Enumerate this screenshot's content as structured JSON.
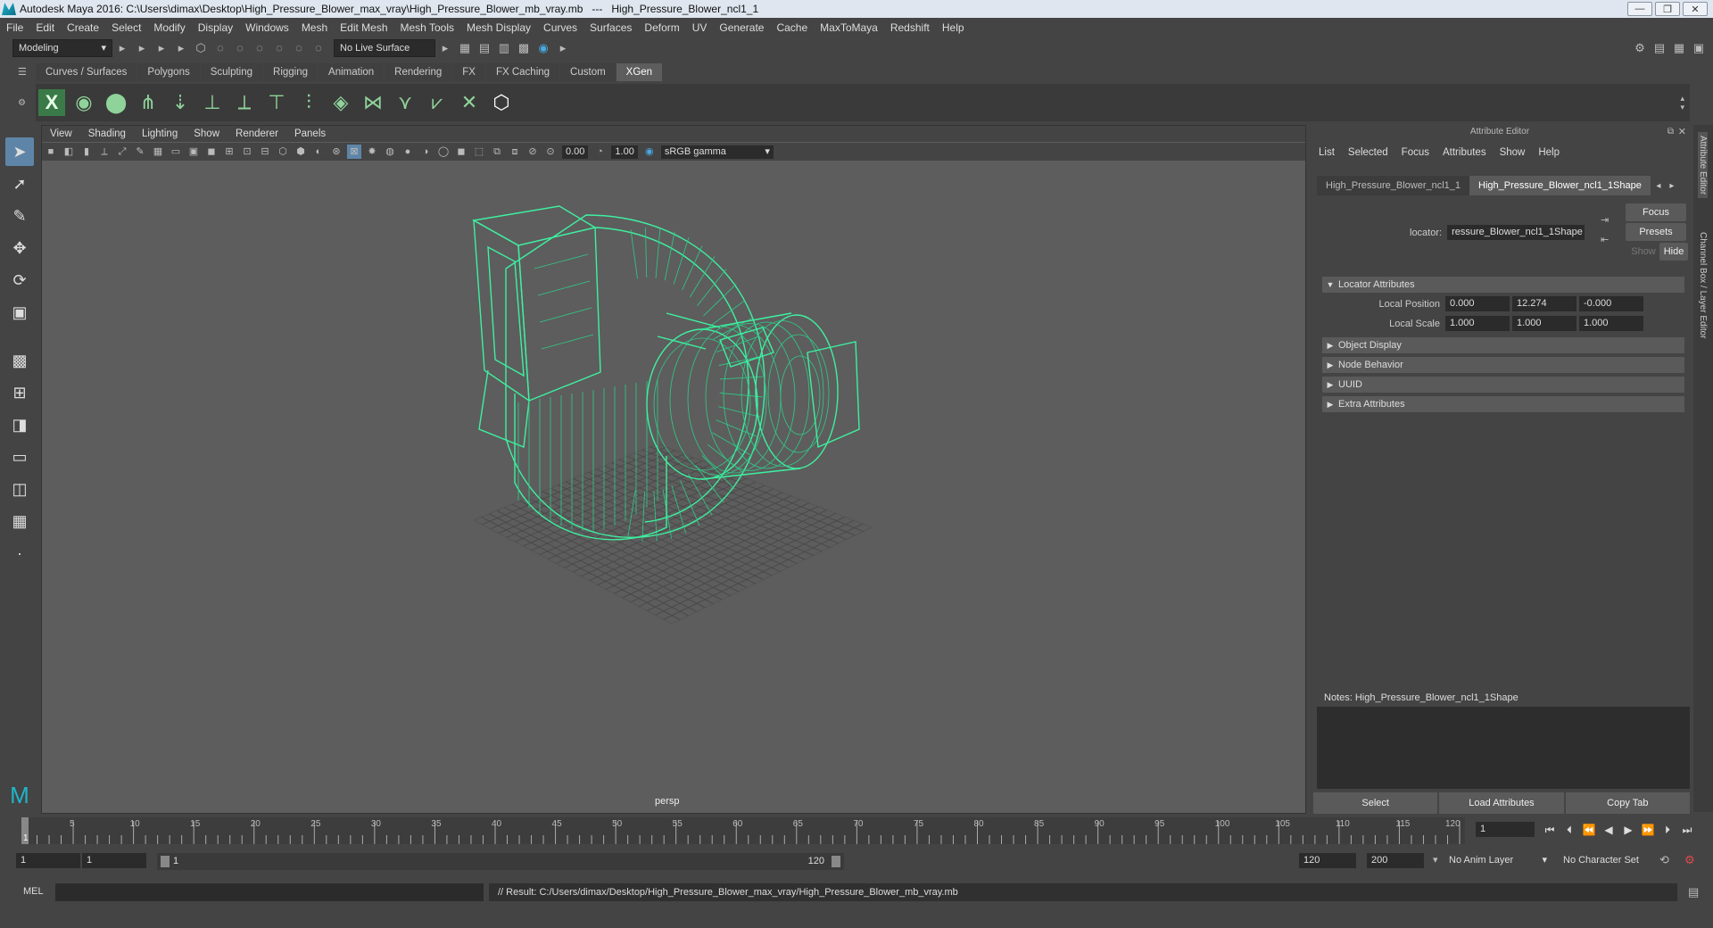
{
  "window": {
    "title": "Autodesk Maya 2016: C:\\Users\\dimax\\Desktop\\High_Pressure_Blower_max_vray\\High_Pressure_Blower_mb_vray.mb   ---   High_Pressure_Blower_ncl1_1",
    "buttons": [
      "—",
      "❐",
      "✕"
    ]
  },
  "menubar": [
    "File",
    "Edit",
    "Create",
    "Select",
    "Modify",
    "Display",
    "Windows",
    "Mesh",
    "Edit Mesh",
    "Mesh Tools",
    "Mesh Display",
    "Curves",
    "Surfaces",
    "Deform",
    "UV",
    "Generate",
    "Cache",
    "MaxToMaya",
    "Redshift",
    "Help"
  ],
  "statusline": {
    "mode": "Modeling",
    "live_surface": "No Live Surface"
  },
  "shelf": {
    "tabs": [
      "Curves / Surfaces",
      "Polygons",
      "Sculpting",
      "Rigging",
      "Animation",
      "Rendering",
      "FX",
      "FX Caching",
      "Custom",
      "XGen"
    ],
    "active": "XGen"
  },
  "viewport": {
    "menu": [
      "View",
      "Shading",
      "Lighting",
      "Show",
      "Renderer",
      "Panels"
    ],
    "exposure": "0.00",
    "gamma": "1.00",
    "color_space": "sRGB gamma",
    "camera_label": "persp",
    "wire_color": "#3ef0a0"
  },
  "attribute_editor": {
    "header": "Attribute Editor",
    "menu": [
      "List",
      "Selected",
      "Focus",
      "Attributes",
      "Show",
      "Help"
    ],
    "tabs": [
      "High_Pressure_Blower_ncl1_1",
      "High_Pressure_Blower_ncl1_1Shape"
    ],
    "active_tab": "High_Pressure_Blower_ncl1_1Shape",
    "locator_label": "locator:",
    "locator_value": "ressure_Blower_ncl1_1Shape",
    "focus_btn": "Focus",
    "presets_btn": "Presets",
    "show_btn": "Show",
    "hide_btn": "Hide",
    "sections": {
      "locator_attributes": "Locator Attributes",
      "object_display": "Object Display",
      "node_behavior": "Node Behavior",
      "uuid": "UUID",
      "extra_attributes": "Extra Attributes"
    },
    "local_position_label": "Local Position",
    "local_position": [
      "0.000",
      "12.274",
      "-0.000"
    ],
    "local_scale_label": "Local Scale",
    "local_scale": [
      "1.000",
      "1.000",
      "1.000"
    ],
    "notes_label": "Notes:  High_Pressure_Blower_ncl1_1Shape",
    "bottom_buttons": [
      "Select",
      "Load Attributes",
      "Copy Tab"
    ]
  },
  "side_tabs": [
    "Attribute Editor",
    "Channel Box / Layer Editor"
  ],
  "timeline": {
    "ticks": [
      "5",
      "10",
      "15",
      "20",
      "25",
      "30",
      "35",
      "40",
      "45",
      "50",
      "55",
      "60",
      "65",
      "70",
      "75",
      "80",
      "85",
      "90",
      "95",
      "100",
      "105",
      "110",
      "115",
      "120"
    ],
    "start_label": "1",
    "current_frame": "1"
  },
  "range": {
    "start": "1",
    "playback_start": "1",
    "slider_start": "1",
    "slider_end": "120",
    "playback_end": "120",
    "end": "200",
    "anim_layer": "No Anim Layer",
    "character_set": "No Character Set"
  },
  "cmdline": {
    "lang": "MEL",
    "result": "// Result: C:/Users/dimax/Desktop/High_Pressure_Blower_max_vray/High_Pressure_Blower_mb_vray.mb"
  }
}
